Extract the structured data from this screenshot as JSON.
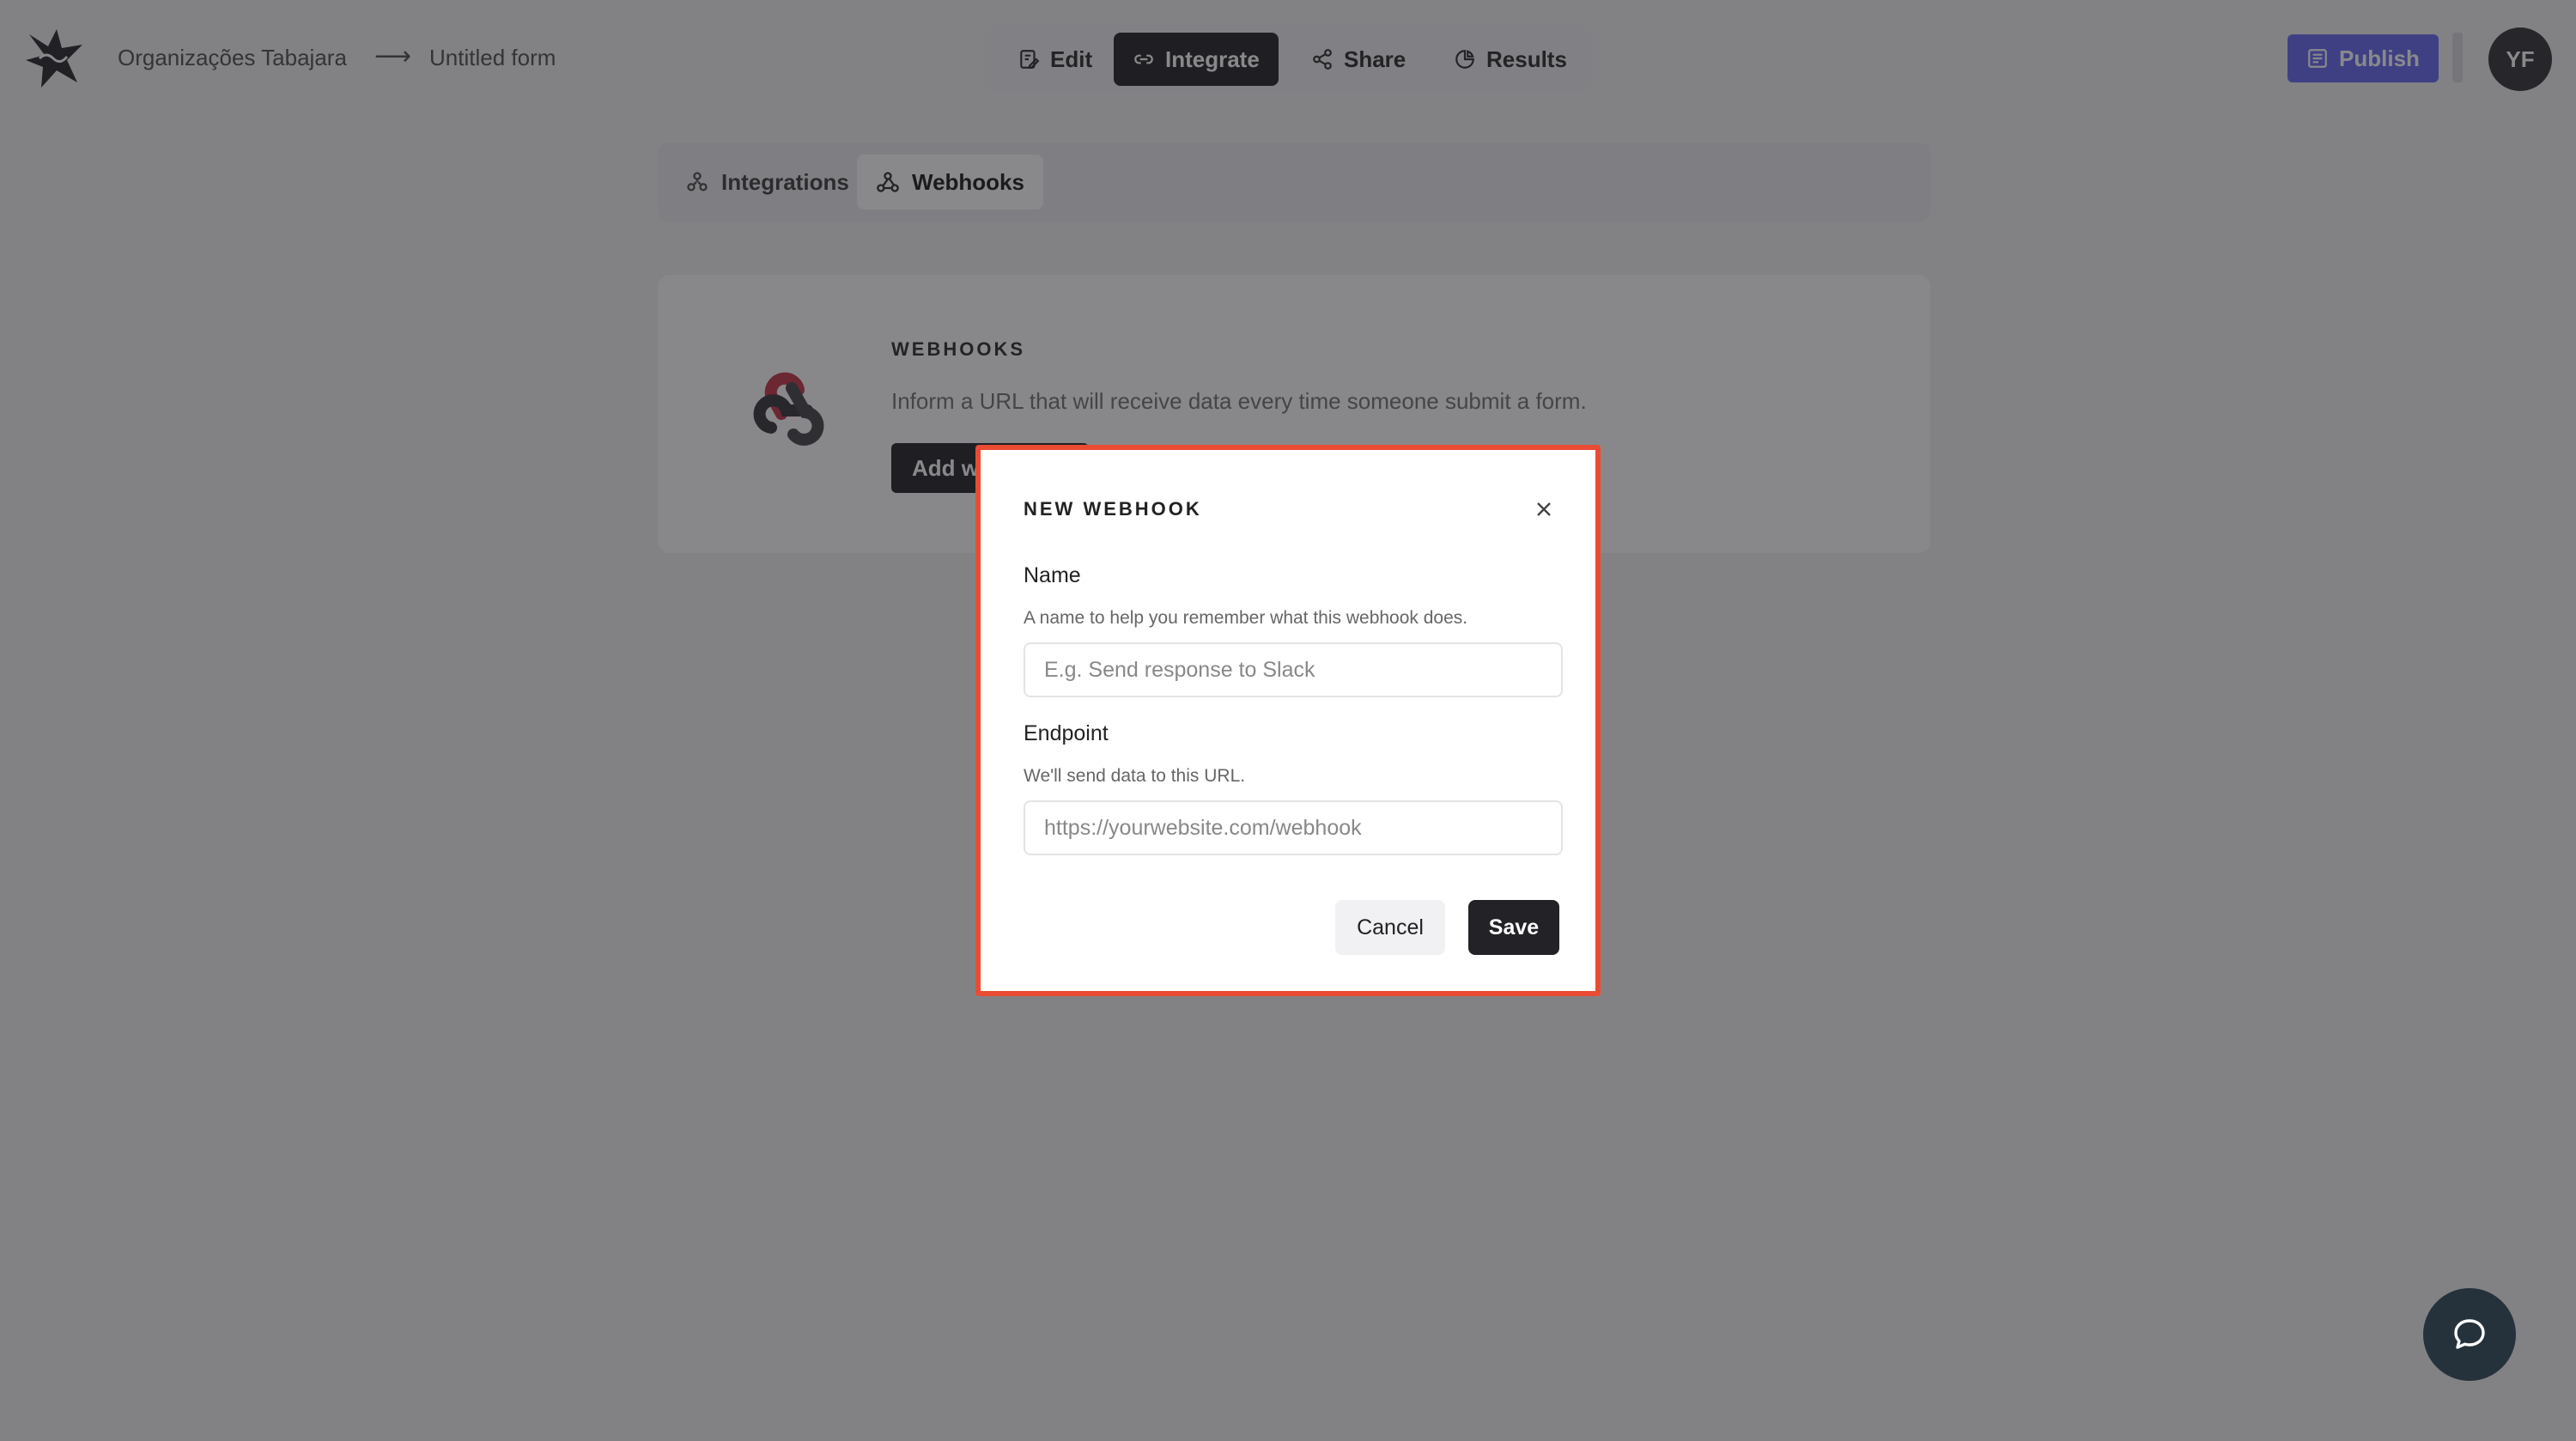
{
  "header": {
    "breadcrumb": {
      "org": "Organizações Tabajara",
      "separator": "⟶",
      "form": "Untitled form"
    },
    "nav": [
      {
        "label": "Edit",
        "icon": "edit-icon",
        "active": false
      },
      {
        "label": "Integrate",
        "icon": "link-icon",
        "active": true
      },
      {
        "label": "Share",
        "icon": "share-icon",
        "active": false
      },
      {
        "label": "Results",
        "icon": "pie-chart-icon",
        "active": false
      }
    ],
    "publish_label": "Publish",
    "avatar_initials": "YF"
  },
  "subnav": {
    "tabs": [
      {
        "label": "Integrations",
        "icon": "integrations-icon",
        "active": false
      },
      {
        "label": "Webhooks",
        "icon": "webhook-icon",
        "active": true
      }
    ]
  },
  "webhooks_card": {
    "title": "WEBHOOKS",
    "description": "Inform a URL that will receive data every time someone submit a form.",
    "add_button_label": "Add w"
  },
  "modal": {
    "title": "NEW WEBHOOK",
    "name": {
      "label": "Name",
      "help": "A name to help you remember what this webhook does.",
      "value": "",
      "placeholder": "E.g. Send response to Slack"
    },
    "endpoint": {
      "label": "Endpoint",
      "help": "We'll send data to this URL.",
      "value": "",
      "placeholder": "https://yourwebsite.com/webhook"
    },
    "cancel_label": "Cancel",
    "save_label": "Save"
  },
  "colors": {
    "accent": "#6a6cf1",
    "dark": "#2b2b2f",
    "highlight": "#ea4b33",
    "webhook_icon_red": "#c23b4d"
  }
}
